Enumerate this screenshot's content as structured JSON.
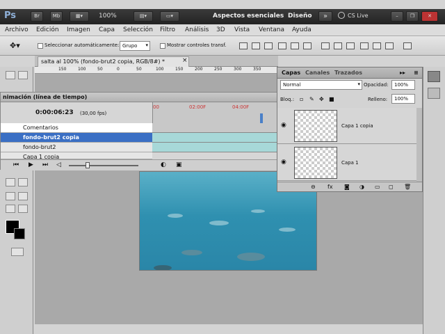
{
  "app": {
    "logo": "Ps",
    "btn_br": "Br",
    "btn_mb": "Mb",
    "zoom": "100%",
    "workspace_main": "Aspectos esenciales",
    "workspace_alt": "Diseño",
    "cslive": "CS Live"
  },
  "menu": [
    "Archivo",
    "Edición",
    "Imagen",
    "Capa",
    "Selección",
    "Filtro",
    "Análisis",
    "3D",
    "Vista",
    "Ventana",
    "Ayuda"
  ],
  "options": {
    "auto_select": "Seleccionar automáticamente:",
    "auto_select_value": "Grupo",
    "show_transform": "Mostrar controles transf."
  },
  "document": {
    "tab_title": "salta al 100% (fondo-brut2 copia, RGB/8#) *",
    "close": "×",
    "ruler": [
      "150",
      "100",
      "50",
      "0",
      "50",
      "100",
      "150",
      "200",
      "250",
      "300",
      "350"
    ]
  },
  "timeline": {
    "title": "nimación (línea de tiempo)",
    "timecode": "0:00:06:23",
    "fps": "(30,00 fps)",
    "ticks": [
      "00",
      "02:00F",
      "04:00F"
    ],
    "rows": [
      "Comentarios",
      "fondo-brut2 copia",
      "fondo-brut2",
      "Capa 1 copia"
    ]
  },
  "layers": {
    "tabs": [
      "Capas",
      "Canales",
      "Trazados"
    ],
    "blend_mode": "Normal",
    "opacity_label": "Opacidad:",
    "opacity_value": "100%",
    "lock_label": "Bloq.:",
    "fill_label": "Relleno:",
    "fill_value": "100%",
    "items": [
      "Capa 1 copia",
      "Capa 1"
    ]
  },
  "colors": {
    "appbar": "#2b2b2b",
    "selected_row": "#3a6fc4",
    "track": "#a7d8d8",
    "water": "#2f90b0"
  }
}
